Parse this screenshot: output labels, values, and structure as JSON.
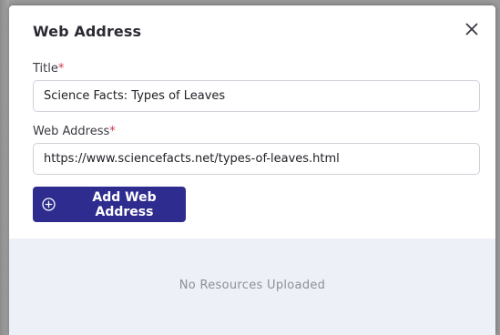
{
  "dialog": {
    "title": "Web Address",
    "close_icon": "close-icon"
  },
  "form": {
    "title_label": "Title",
    "title_required_mark": "*",
    "title_value": "Science Facts: Types of Leaves",
    "web_label": "Web Address",
    "web_required_mark": "*",
    "web_value": "https://www.sciencefacts.net/types-of-leaves.html",
    "add_button_label": "Add Web Address",
    "add_button_icon": "plus-circle-icon"
  },
  "resources": {
    "empty_message": "No Resources Uploaded"
  },
  "colors": {
    "primary": "#2e2c8e",
    "required": "#d0364c",
    "resources_bg": "#eef0f7"
  }
}
